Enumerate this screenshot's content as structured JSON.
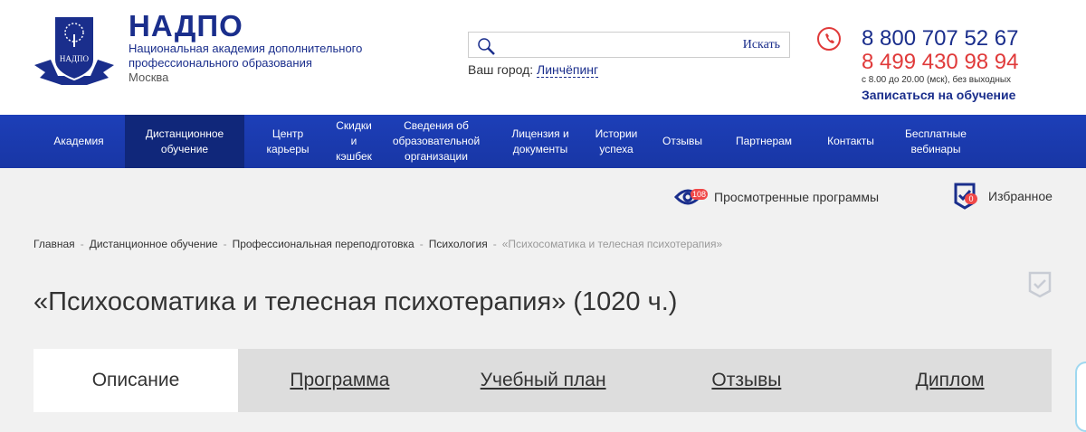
{
  "header": {
    "brand": "НАДПО",
    "subtitle1": "Национальная академия дополнительного",
    "subtitle2": "профессионального образования",
    "city_name": "Москва",
    "logo_text": "НАДПО",
    "search_button": "Искать",
    "search_placeholder": "",
    "city_label": "Ваш город:",
    "city_value": "Линчёпинг",
    "phone1": "8 800 707 52 67",
    "phone2": "8 499 430 98 94",
    "hours": "с 8.00 до 20.00 (мск), без выходных",
    "enroll": "Записаться на обучение"
  },
  "nav": [
    "Академия",
    "Дистанционное обучение",
    "Центр карьеры",
    "Скидки и кэшбек",
    "Сведения об образовательной организации",
    "Лицензия и документы",
    "Истории успеха",
    "Отзывы",
    "Партнерам",
    "Контакты",
    "Бесплатные вебинары"
  ],
  "tools": {
    "viewed_label": "Просмотренные программы",
    "viewed_count": "108",
    "fav_label": "Избранное",
    "fav_count": "0"
  },
  "breadcrumbs": [
    "Главная",
    "Дистанционное обучение",
    "Профессиональная переподготовка",
    "Психология",
    "«Психосоматика и телесная психотерапия»"
  ],
  "title": "«Психосоматика и телесная психотерапия» (1020 ч.)",
  "tabs": [
    "Описание",
    "Программа",
    "Учебный план",
    "Отзывы",
    "Диплом"
  ]
}
